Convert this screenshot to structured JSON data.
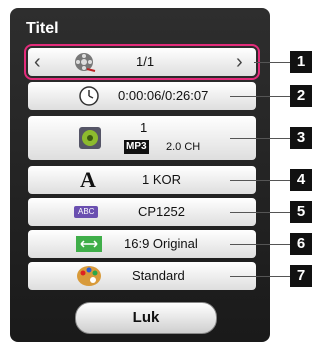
{
  "dialog": {
    "title": "Titel",
    "rows": [
      {
        "value": "1/1"
      },
      {
        "value": "0:00:06/0:26:07"
      },
      {
        "line1": "1",
        "codec": "MP3",
        "channels": "2.0 CH"
      },
      {
        "value": "1 KOR",
        "icon_glyph": "A"
      },
      {
        "value": "CP1252",
        "icon_text": "ABC"
      },
      {
        "value": "16:9 Original"
      },
      {
        "value": "Standard"
      }
    ],
    "close_label": "Luk"
  },
  "callouts": [
    "1",
    "2",
    "3",
    "4",
    "5",
    "6",
    "7"
  ],
  "colors": {
    "highlight": "#e32b7a",
    "panel": "#1a1a1a"
  }
}
